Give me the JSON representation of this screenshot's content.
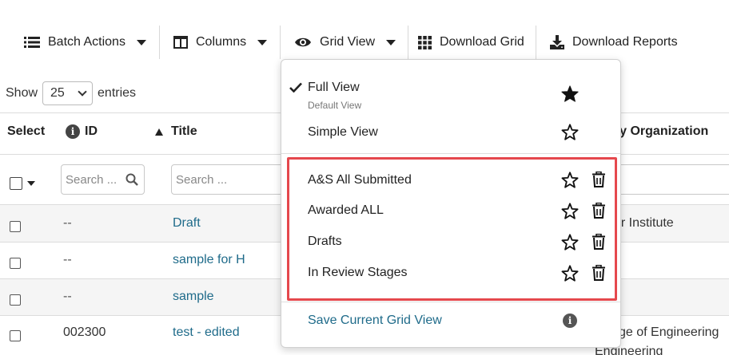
{
  "toolbar": {
    "batch_actions": "Batch Actions",
    "columns": "Columns",
    "grid_view": "Grid View",
    "download_grid": "Download Grid",
    "download_reports": "Download Reports"
  },
  "entries": {
    "show_label": "Show",
    "page_size": "25",
    "entries_label": "entries"
  },
  "table": {
    "headers": {
      "select": "Select",
      "id": "ID",
      "title": "Title",
      "primary_org": "ary Organization"
    },
    "filters": {
      "id_placeholder": "Search ...",
      "title_placeholder": "Search ..."
    },
    "rows": [
      {
        "id": "--",
        "title": "Draft",
        "org": "cer Institute"
      },
      {
        "id": "--",
        "title": "sample for H",
        "org": ""
      },
      {
        "id": "--",
        "title": "sample",
        "org": ""
      },
      {
        "id": "002300",
        "title": "test - edited",
        "org": "llege of Engineering",
        "org2": "Engineering"
      }
    ]
  },
  "grid_view_menu": {
    "full_view": "Full View",
    "full_view_sub": "Default View",
    "simple_view": "Simple View",
    "saved_views": [
      "A&S All Submitted",
      "Awarded ALL",
      "Drafts",
      "In Review Stages"
    ],
    "save_current": "Save Current Grid View"
  },
  "colors": {
    "link": "#1f6b8a",
    "highlight": "#e5484d",
    "row_alt": "#f5f5f5"
  }
}
